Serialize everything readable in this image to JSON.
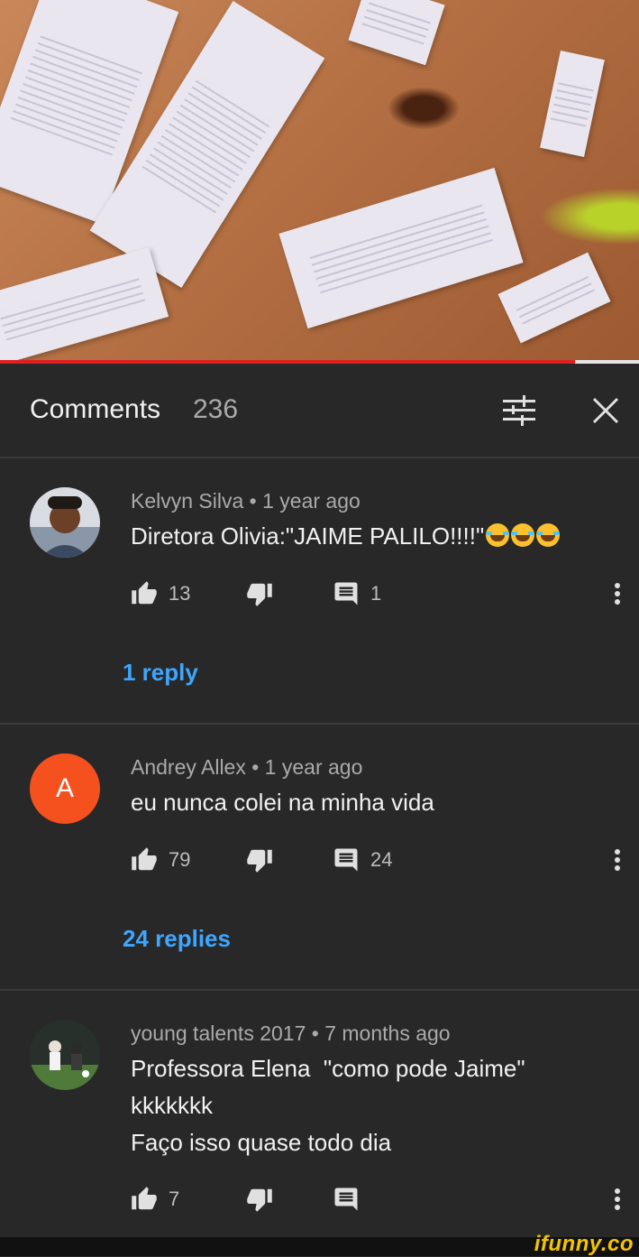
{
  "video": {
    "progress_percent": 90
  },
  "header": {
    "title": "Comments",
    "count": "236"
  },
  "comments": [
    {
      "author": "Kelvyn Silva",
      "time": "1 year ago",
      "meta": "Kelvyn Silva • 1 year ago",
      "lines": [
        "Diretora Olivia:\"JAIME PALILO!!!!\""
      ],
      "emoji_count": 3,
      "likes": "13",
      "reply_count": "1",
      "replies_link": "1 reply",
      "avatar_type": "photo"
    },
    {
      "author": "Andrey Allex",
      "time": "1 year ago",
      "meta": "Andrey Allex • 1 year ago",
      "lines": [
        "eu nunca colei na minha vida"
      ],
      "likes": "79",
      "reply_count": "24",
      "replies_link": "24 replies",
      "avatar_letter": "A",
      "avatar_color": "#f4511e"
    },
    {
      "author": "young talents 2017",
      "time": "7 months ago",
      "meta": "young talents 2017 • 7 months ago",
      "lines": [
        "Professora Elena  \"como pode Jaime\"",
        "kkkkkkk",
        "Faço isso quase todo dia"
      ],
      "likes": "7",
      "reply_count": "",
      "avatar_type": "photo"
    }
  ],
  "icons": {
    "like": "thumb-up-icon",
    "dislike": "thumb-down-icon",
    "reply": "comment-icon",
    "more": "more-vert-icon",
    "filter": "sort-filter-icon",
    "close": "close-icon"
  },
  "watermark": "ifunny.co",
  "colors": {
    "accent_link": "#3ea6ff",
    "progress": "#e02020",
    "background": "#282828"
  }
}
